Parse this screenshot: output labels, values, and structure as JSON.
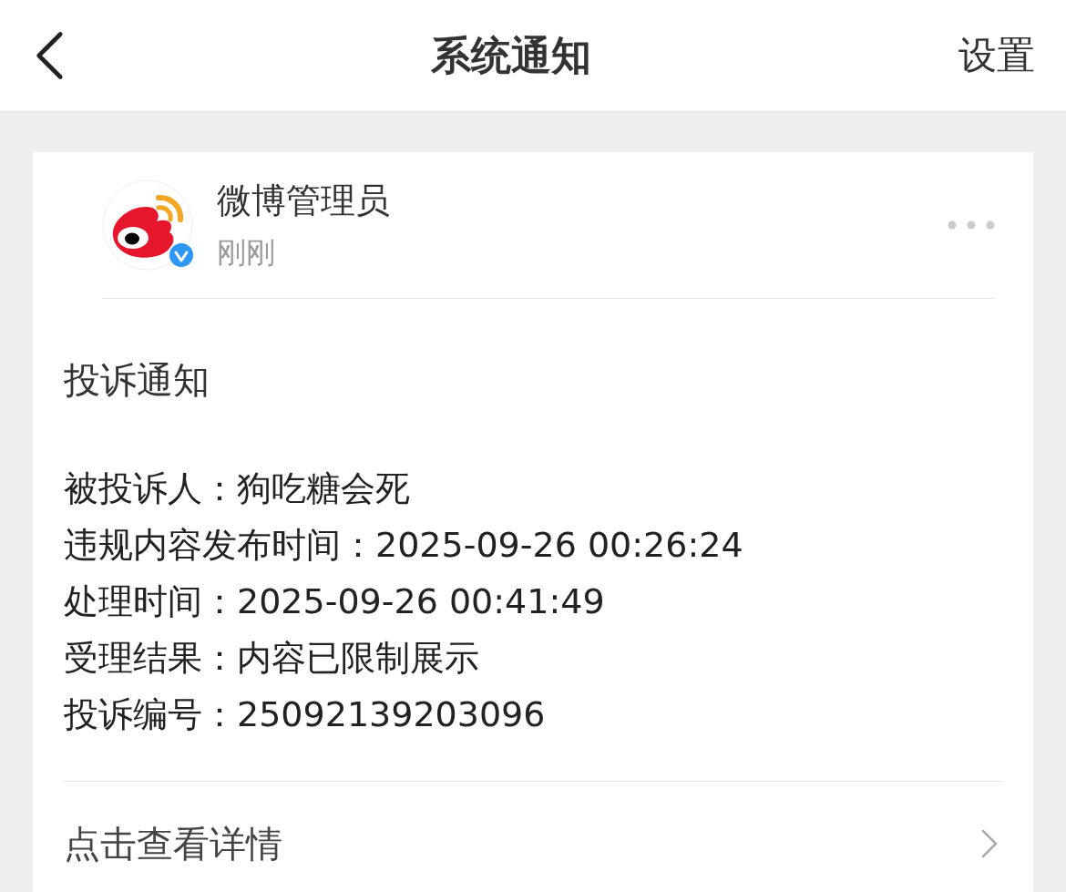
{
  "nav": {
    "title": "系统通知",
    "action": "设置"
  },
  "message": {
    "sender": "微博管理员",
    "verified": true,
    "time": "刚刚",
    "heading": "投诉通知",
    "fields": [
      {
        "label": "被投诉人：",
        "value": "狗吃糖会死"
      },
      {
        "label": "违规内容发布时间：",
        "value": "2025-09-26 00:26:24"
      },
      {
        "label": "处理时间：",
        "value": "2025-09-26 00:41:49"
      },
      {
        "label": "受理结果：",
        "value": "内容已限制展示"
      },
      {
        "label": "投诉编号：",
        "value": "25092139203096"
      }
    ],
    "link": "点击查看详情"
  }
}
